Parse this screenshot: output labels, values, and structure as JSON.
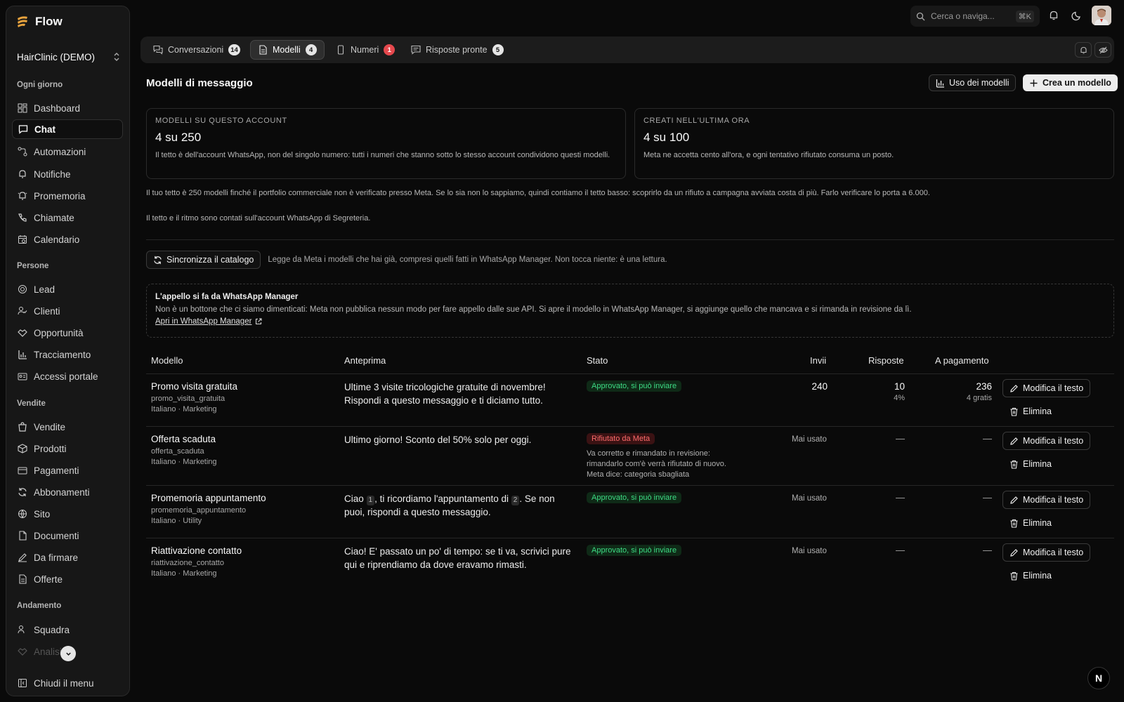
{
  "sidebar": {
    "brand": "Flow",
    "org": "HairClinic (DEMO)",
    "sections": {
      "daily": "Ogni giorno",
      "people": "Persone",
      "sales": "Vendite",
      "trend": "Andamento"
    },
    "daily_items": [
      "Dashboard",
      "Chat",
      "Automazioni",
      "Notifiche",
      "Promemoria",
      "Chiamate",
      "Calendario"
    ],
    "people_items": [
      "Lead",
      "Clienti",
      "Opportunità",
      "Tracciamento",
      "Accessi portale"
    ],
    "sales_items": [
      "Vendite",
      "Prodotti",
      "Pagamenti",
      "Abbonamenti",
      "Sito",
      "Documenti",
      "Da firmare",
      "Offerte"
    ],
    "trend_items": [
      "Squadra",
      "Analisi"
    ],
    "collapse_label": "Chiudi il menu"
  },
  "topbar": {
    "search_placeholder": "Cerca o naviga...",
    "shortcut": "⌘K"
  },
  "tabs": [
    {
      "label": "Conversazioni",
      "count": "14"
    },
    {
      "label": "Modelli",
      "count": "4"
    },
    {
      "label": "Numeri",
      "count": "1"
    },
    {
      "label": "Risposte pronte",
      "count": "5"
    }
  ],
  "page": {
    "title": "Modelli di messaggio",
    "usage_button": "Uso dei modelli",
    "create_button": "Crea un modello"
  },
  "cards": [
    {
      "label": "MODELLI SU QUESTO ACCOUNT",
      "value": "4 su 250",
      "note": "Il tetto è dell'account WhatsApp, non del singolo numero: tutti i numeri che stanno sotto lo stesso account condividono questi modelli."
    },
    {
      "label": "CREATI NELL'ULTIMA ORA",
      "value": "4 su 100",
      "note": "Meta ne accetta cento all'ora, e ogni tentativo rifiutato consuma un posto."
    }
  ],
  "info": {
    "line1": "Il tuo tetto è 250 modelli finché il portfolio commerciale non è verificato presso Meta. Se lo sia non lo sappiamo, quindi contiamo il tetto basso: scoprirlo da un rifiuto a campagna avviata costa di più. Farlo verificare lo porta a 6.000.",
    "line2": "Il tetto e il ritmo sono contati sull'account WhatsApp di Segreteria."
  },
  "sync": {
    "button": "Sincronizza il catalogo",
    "note": "Legge da Meta i modelli che hai già, compresi quelli fatti in WhatsApp Manager. Non tocca niente: è una lettura."
  },
  "appeal": {
    "title": "L'appello si fa da WhatsApp Manager",
    "text": "Non è un bottone che ci siamo dimenticati: Meta non pubblica nessun modo per fare appello dalle sue API. Si apre il modello in WhatsApp Manager, si aggiunge quello che mancava e si rimanda in revisione da lì.",
    "link": "Apri in WhatsApp Manager"
  },
  "table": {
    "headers": {
      "model": "Modello",
      "preview": "Anteprima",
      "status": "Stato",
      "sends": "Invii",
      "replies": "Risposte",
      "paid": "A pagamento"
    },
    "edit_label": "Modifica il testo",
    "delete_label": "Elimina",
    "rows": [
      {
        "name": "Promo visita gratuita",
        "key": "promo_visita_gratuita",
        "lang": "Italiano · Marketing",
        "preview": "Ultime 3 visite tricologiche gratuite di novembre! Rispondi a questo messaggio e ti diciamo tutto.",
        "status": "Approvato, si può inviare",
        "sends": "240",
        "replies": "10",
        "replies_pct": "4%",
        "paid": "236",
        "paid_sub": "4 gratis"
      },
      {
        "name": "Offerta scaduta",
        "key": "offerta_scaduta",
        "lang": "Italiano · Marketing",
        "preview": "Ultimo giorno! Sconto del 50% solo per oggi.",
        "status": "Rifiutato da Meta",
        "status_note1": "Va corretto e rimandato in revisione: rimandarlo com'è verrà rifiutato di nuovo.",
        "status_note2": "Meta dice: categoria sbagliata",
        "sends": "Mai usato",
        "replies": "—",
        "paid": "—"
      },
      {
        "name": "Promemoria appuntamento",
        "key": "promemoria_appuntamento",
        "lang": "Italiano · Utility",
        "preview_a": "Ciao ",
        "ph1": "1",
        "preview_b": ", ti ricordiamo l'appuntamento di ",
        "ph2": "2",
        "preview_c": ". Se non puoi, rispondi a questo messaggio.",
        "status": "Approvato, si può inviare",
        "sends": "Mai usato",
        "replies": "—",
        "paid": "—"
      },
      {
        "name": "Riattivazione contatto",
        "key": "riattivazione_contatto",
        "lang": "Italiano · Marketing",
        "preview": "Ciao! E' passato un po' di tempo: se ti va, scrivici pure qui e riprendiamo da dove eravamo rimasti.",
        "status": "Approvato, si può inviare",
        "sends": "Mai usato",
        "replies": "—",
        "paid": "—"
      }
    ]
  },
  "colors": {
    "background": "#0a0a0a",
    "approved": "#3ddc84",
    "rejected": "#ff6b6b",
    "badge_alert": "#e5484d",
    "brand": "#e8a33d"
  },
  "dev_badge": "N"
}
